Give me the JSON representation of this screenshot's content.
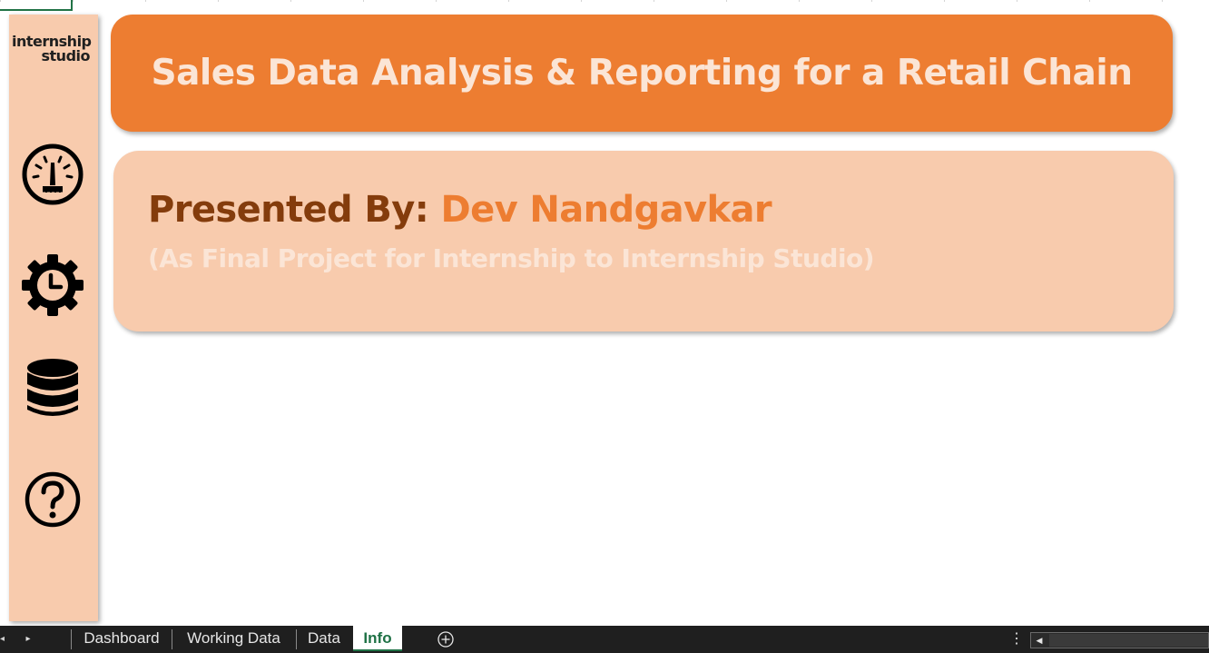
{
  "logo": {
    "line1": "internship",
    "line2": "studio"
  },
  "sidebar": {
    "items": [
      {
        "icon": "dashboard-gauge-icon"
      },
      {
        "icon": "settings-clock-icon"
      },
      {
        "icon": "database-icon"
      },
      {
        "icon": "help-icon"
      }
    ]
  },
  "title": {
    "text": "Sales Data Analysis & Reporting for a Retail Chain"
  },
  "presenter": {
    "label": "Presented By:",
    "name": "Dev Nandgavkar",
    "subtitle": "(As Final Project for Internship to Internship Studio)"
  },
  "tabs": [
    {
      "label": "Dashboard",
      "active": false
    },
    {
      "label": "Working Data",
      "active": false
    },
    {
      "label": "Data",
      "active": false
    },
    {
      "label": "Info",
      "active": true
    }
  ],
  "colors": {
    "accent_orange": "#ed7d31",
    "light_peach": "#f8cbad",
    "pale_peach_text": "#fbe5d6",
    "dark_brown": "#843c0c",
    "excel_green": "#1e7145"
  }
}
